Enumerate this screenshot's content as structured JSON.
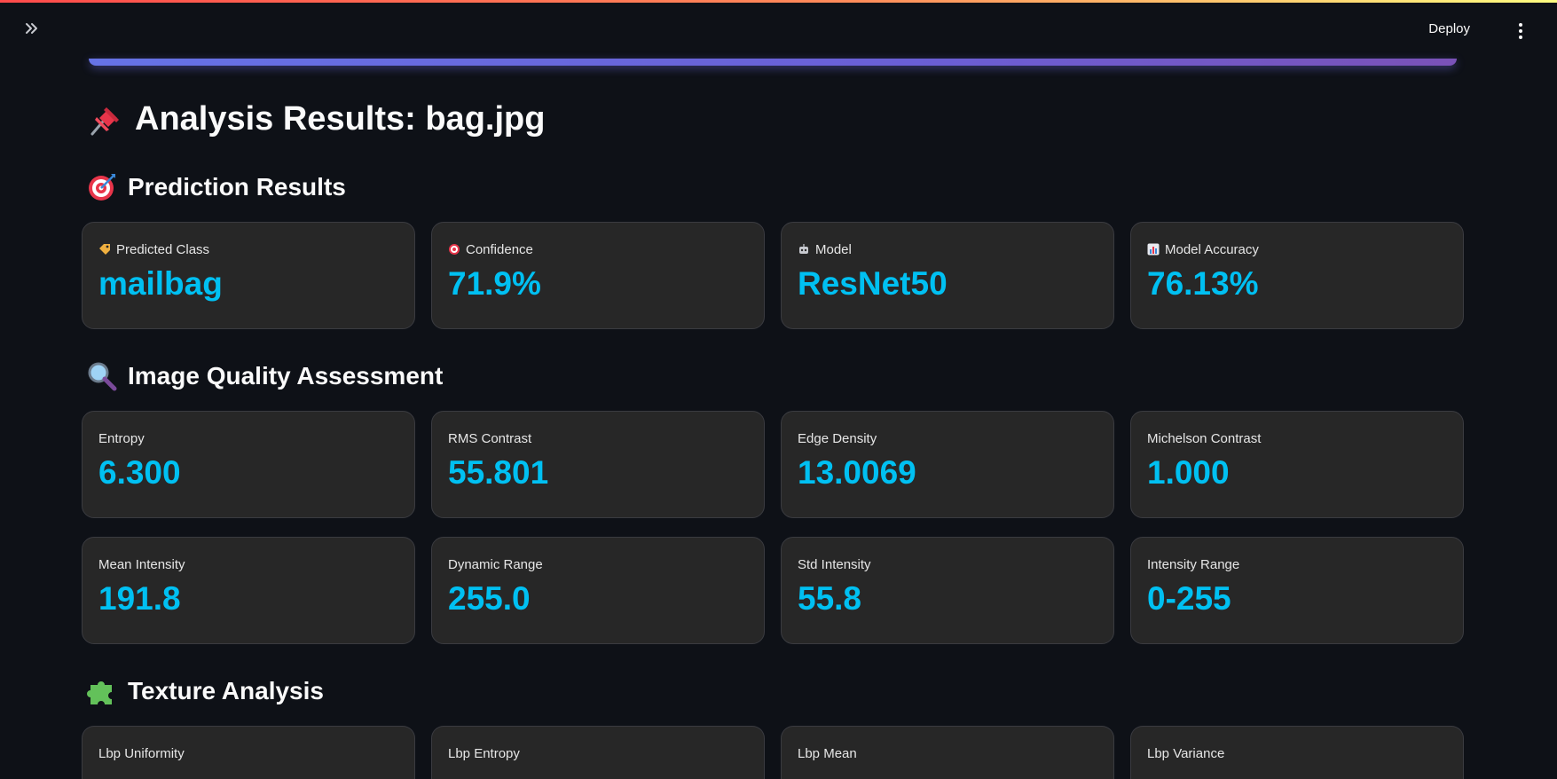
{
  "toolbar": {
    "deploy_label": "Deploy",
    "sidebar_toggle_glyph": "»"
  },
  "page_title": "Analysis Results: bag.jpg",
  "sections": {
    "prediction": {
      "title": "Prediction Results",
      "cards": [
        {
          "label": "Predicted Class",
          "value": "mailbag",
          "icon": "tag-icon"
        },
        {
          "label": "Confidence",
          "value": "71.9%",
          "icon": "target-icon"
        },
        {
          "label": "Model",
          "value": "ResNet50",
          "icon": "robot-icon"
        },
        {
          "label": "Model Accuracy",
          "value": "76.13%",
          "icon": "bar-chart-icon"
        }
      ]
    },
    "quality": {
      "title": "Image Quality Assessment",
      "cards": [
        {
          "label": "Entropy",
          "value": "6.300"
        },
        {
          "label": "RMS Contrast",
          "value": "55.801"
        },
        {
          "label": "Edge Density",
          "value": "13.0069"
        },
        {
          "label": "Michelson Contrast",
          "value": "1.000"
        },
        {
          "label": "Mean Intensity",
          "value": "191.8"
        },
        {
          "label": "Dynamic Range",
          "value": "255.0"
        },
        {
          "label": "Std Intensity",
          "value": "55.8"
        },
        {
          "label": "Intensity Range",
          "value": "0-255"
        }
      ]
    },
    "texture": {
      "title": "Texture Analysis",
      "cards": [
        {
          "label": "Lbp Uniformity"
        },
        {
          "label": "Lbp Entropy"
        },
        {
          "label": "Lbp Mean"
        },
        {
          "label": "Lbp Variance"
        }
      ]
    }
  },
  "colors": {
    "background": "#0e1117",
    "card_bg": "#272727",
    "value_accent": "#00c0f2",
    "banner_gradient_start": "#6673e6",
    "banner_gradient_end": "#7a52b8"
  }
}
